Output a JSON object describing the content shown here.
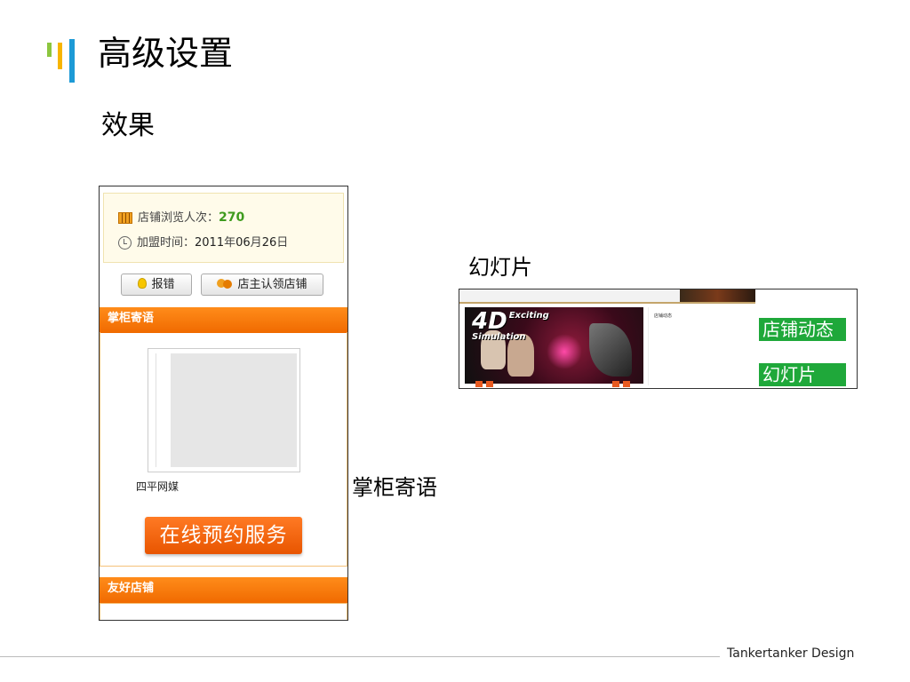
{
  "slide": {
    "title": "高级设置",
    "subtitle": "效果"
  },
  "shop_panel": {
    "visits_label": "店铺浏览人次：",
    "visits_value": "270",
    "join_label": "加盟时间：",
    "join_year": "2011",
    "join_year_unit": "年",
    "join_month": "06",
    "join_month_unit": "月",
    "join_day": "26",
    "join_day_unit": "日",
    "report_button": "报错",
    "claim_button": "店主认领店铺",
    "section_title": "掌柜寄语",
    "shop_name": "四平网媒",
    "book_button": "在线预约服务",
    "friends_title": "友好店铺"
  },
  "callouts": {
    "guide": "掌柜寄语",
    "slideshow": "幻灯片"
  },
  "slideshow": {
    "hero_big": "4D",
    "hero_line1": "Exciting",
    "hero_line2": "Simulation",
    "news_title": "店铺动态",
    "label_news": "店铺动态",
    "label_slides": "幻灯片"
  },
  "footer": {
    "brand": "Tankertanker Design"
  },
  "colors": {
    "accent_orange": "#f06a00",
    "label_green": "#1fa83a",
    "value_green": "#3e9b1e",
    "bar_green": "#8cc63f",
    "bar_yellow": "#f7b500",
    "bar_blue": "#1d9ad6"
  }
}
